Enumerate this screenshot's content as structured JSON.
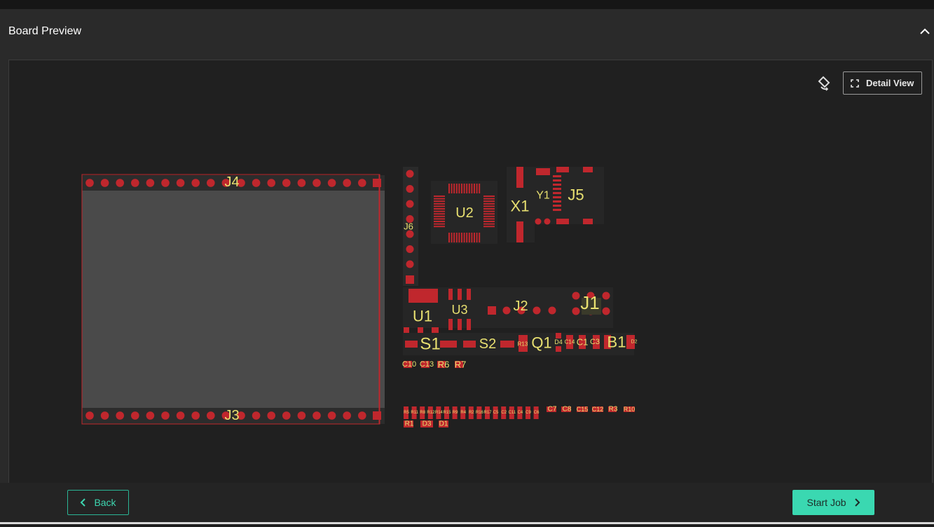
{
  "panel": {
    "title": "Board Preview"
  },
  "toolbar": {
    "detail_view_label": "Detail View"
  },
  "footer": {
    "back_label": "Back",
    "start_label": "Start Job"
  },
  "colors": {
    "pad": "#c0272d",
    "silkscreen": "#e8e070",
    "accent": "#3ad8b1",
    "module_body": "#4a4a4a"
  },
  "board": {
    "designators": {
      "J4": "J4",
      "J3": "J3",
      "J6": "J6",
      "U2": "U2",
      "X1": "X1",
      "Y1": "Y1",
      "J5": "J5",
      "U1": "U1",
      "U3": "U3",
      "J2": "J2",
      "J1": "J1",
      "S1": "S1",
      "S2": "S2",
      "R13": "R13",
      "Q1": "Q1",
      "D4": "D4",
      "C14": "C14",
      "C1": "C1",
      "C3": "C3",
      "B1": "B1",
      "D2": "D2",
      "C10": "C10",
      "C13": "C13",
      "R6": "R6",
      "R7": "R7",
      "C7": "C7",
      "C8": "C8",
      "C15": "C15",
      "C12": "C12",
      "R3": "R3",
      "R10": "R10",
      "R1": "R1",
      "D3": "D3",
      "D1": "D1"
    },
    "small_parts_row": [
      "R5",
      "R11",
      "R8",
      "R12",
      "R14",
      "R15",
      "R9",
      "R4",
      "R2",
      "R16",
      "R17",
      "C5",
      "C2",
      "C11",
      "C4",
      "C9",
      "C6"
    ]
  }
}
